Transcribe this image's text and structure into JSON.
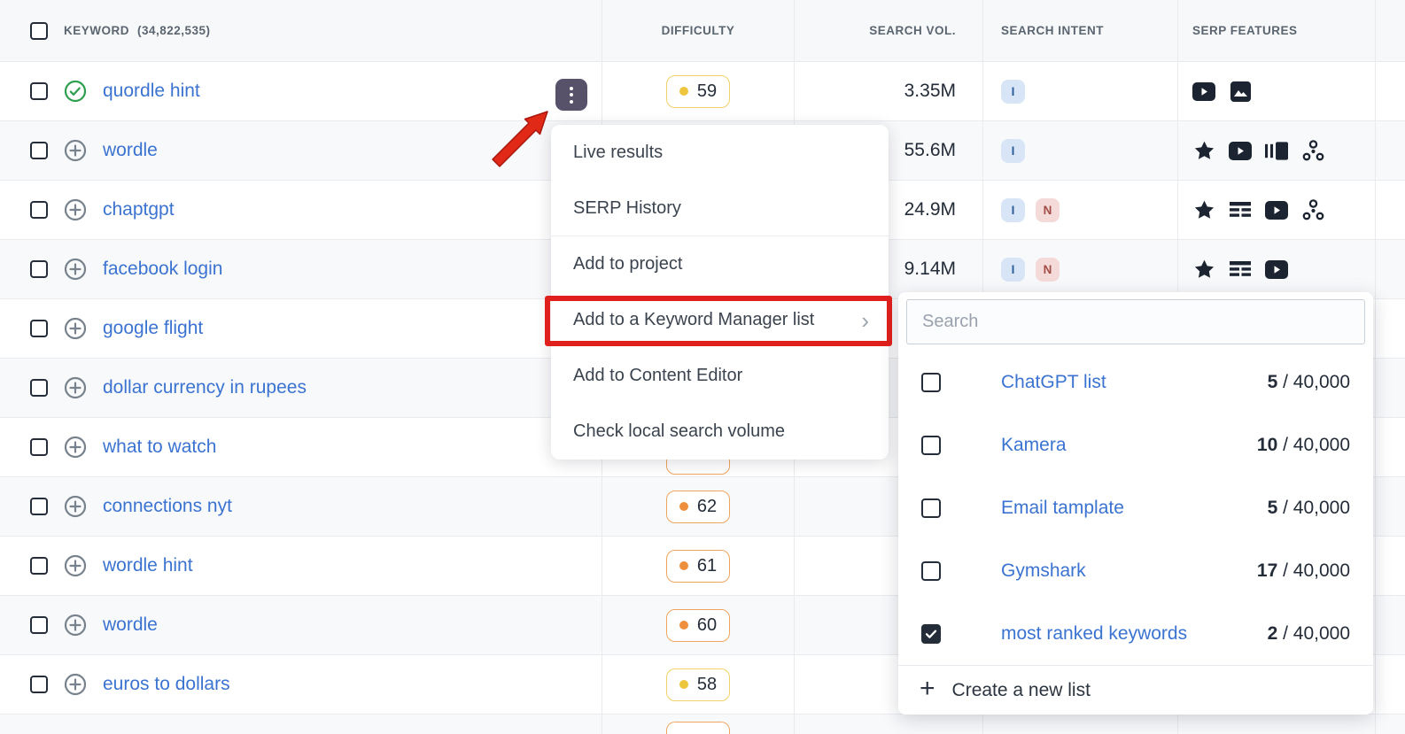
{
  "header": {
    "keyword_label": "KEYWORD",
    "keyword_count": "(34,822,535)",
    "col_difficulty": "DIFFICULTY",
    "col_volume": "SEARCH VOL.",
    "col_intent": "SEARCH INTENT",
    "col_serp": "SERP FEATURES"
  },
  "rows": [
    {
      "keyword": "quordle hint",
      "icon": "check-circle",
      "difficulty": "59",
      "difficulty_level": "yellow",
      "volume": "3.35M",
      "intents": [
        "I"
      ],
      "serp": [
        "video",
        "image"
      ]
    },
    {
      "keyword": "wordle",
      "icon": "plus-circle",
      "intents": [
        "I"
      ],
      "volume": "55.6M",
      "serp": [
        "star",
        "video",
        "carousel",
        "share"
      ]
    },
    {
      "keyword": "chaptgpt",
      "icon": "plus-circle",
      "intents": [
        "I",
        "N"
      ],
      "volume": "24.9M",
      "serp": [
        "star",
        "sitelinks",
        "video",
        "share"
      ]
    },
    {
      "keyword": "facebook login",
      "icon": "plus-circle",
      "intents": [
        "I",
        "N"
      ],
      "volume": "9.14M",
      "serp": [
        "star",
        "sitelinks",
        "video"
      ]
    },
    {
      "keyword": "google flight",
      "icon": "plus-circle"
    },
    {
      "keyword": "dollar currency in rupees",
      "icon": "plus-circle"
    },
    {
      "keyword": "what to watch",
      "icon": "plus-circle",
      "difficulty_partial": true,
      "difficulty_level": "orange"
    },
    {
      "keyword": "connections nyt",
      "icon": "plus-circle",
      "difficulty": "62",
      "difficulty_level": "orange"
    },
    {
      "keyword": "wordle hint",
      "icon": "plus-circle",
      "difficulty": "61",
      "difficulty_level": "orange"
    },
    {
      "keyword": "wordle",
      "icon": "plus-circle",
      "difficulty": "60",
      "difficulty_level": "orange"
    },
    {
      "keyword": "euros to dollars",
      "icon": "plus-circle",
      "difficulty": "58",
      "difficulty_level": "yellow"
    }
  ],
  "partial_row": {
    "difficulty_partial": true,
    "difficulty_level": "orange"
  },
  "menu": {
    "chevron": "›",
    "items": [
      {
        "label": "Live results"
      },
      {
        "label": "SERP History"
      },
      {
        "label": "Add to project"
      },
      {
        "label": "Add to a Keyword Manager list",
        "highlighted": true
      },
      {
        "label": "Add to Content Editor"
      },
      {
        "label": "Check local search volume"
      }
    ]
  },
  "list_panel": {
    "search_placeholder": "Search",
    "lists": [
      {
        "name": "ChatGPT list",
        "count": "5",
        "count_rest": " / 40,000",
        "checked": false
      },
      {
        "name": "Kamera",
        "count": "10",
        "count_rest": " / 40,000",
        "checked": false
      },
      {
        "name": "Email tamplate",
        "count": "5",
        "count_rest": " / 40,000",
        "checked": false
      },
      {
        "name": "Gymshark",
        "count": "17",
        "count_rest": " / 40,000",
        "checked": false
      },
      {
        "name": "most ranked keywords",
        "count": "2",
        "count_rest": " / 40,000",
        "checked": true
      }
    ],
    "create_label": "Create a new list"
  },
  "colors": {
    "link_blue": "#3b73d1",
    "row_alt": "#f8f9fb",
    "header_bg": "#f7f8fa",
    "border": "#e9ebef",
    "kd_yellow": "#eec63e",
    "kd_orange": "#ee8f3d",
    "intent_i_bg": "#d7e5f6",
    "intent_n_bg": "#f4dad8",
    "highlight_red": "#e0201c",
    "actions_button_bg": "#575169"
  }
}
